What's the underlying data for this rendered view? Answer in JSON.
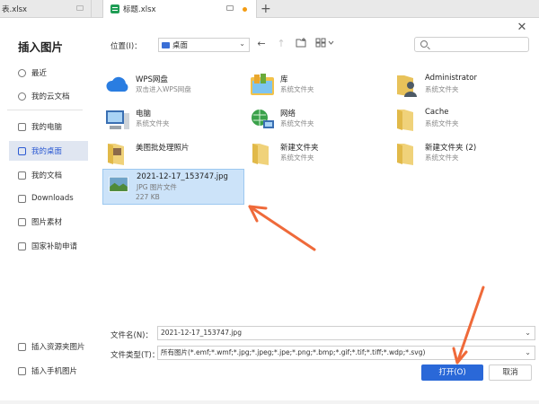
{
  "tabs": {
    "prev_label": "表.xlsx",
    "current_label": "标题.xlsx"
  },
  "dialog": {
    "title": "插入图片",
    "location_label": "位置(I)：",
    "location_value": "桌面"
  },
  "sidebar": {
    "items": [
      {
        "label": "最近",
        "active": false
      },
      {
        "label": "我的云文档",
        "active": false
      },
      {
        "label": "我的电脑",
        "active": false
      },
      {
        "label": "我的桌面",
        "active": true
      },
      {
        "label": "我的文档",
        "active": false
      },
      {
        "label": "Downloads",
        "active": false
      },
      {
        "label": "图片素材",
        "active": false
      },
      {
        "label": "国家补助申请",
        "active": false
      }
    ],
    "bottom": [
      {
        "label": "插入资源夹图片"
      },
      {
        "label": "插入手机图片"
      }
    ]
  },
  "files": [
    {
      "name": "WPS网盘",
      "desc": "双击进入WPS网盘",
      "icon": "cloud-icon"
    },
    {
      "name": "库",
      "desc": "系统文件夹",
      "icon": "library-icon"
    },
    {
      "name": "Administrator",
      "desc": "系统文件夹",
      "icon": "user-folder-icon"
    },
    {
      "name": "电脑",
      "desc": "系统文件夹",
      "icon": "computer-icon"
    },
    {
      "name": "网络",
      "desc": "系统文件夹",
      "icon": "network-icon"
    },
    {
      "name": "Cache",
      "desc": "系统文件夹",
      "icon": "folder-icon"
    },
    {
      "name": "美图批处理照片",
      "desc": "",
      "icon": "folder-icon"
    },
    {
      "name": "新建文件夹",
      "desc": "系统文件夹",
      "icon": "folder-icon"
    },
    {
      "name": "新建文件夹 (2)",
      "desc": "系统文件夹",
      "icon": "folder-icon"
    },
    {
      "name": "2021-12-17_153747.jpg",
      "desc": "JPG 图片文件",
      "size": "227 KB",
      "icon": "image-thumbnail-icon",
      "selected": true
    }
  ],
  "form": {
    "filename_label": "文件名(N)：",
    "filename_value": "2021-12-17_153747.jpg",
    "filetype_label": "文件类型(T)：",
    "filetype_value": "所有图片(*.emf;*.wmf;*.jpg;*.jpeg;*.jpe;*.png;*.bmp;*.gif;*.tif;*.tiff;*.wdp;*.svg)",
    "open_label": "打开(O)",
    "cancel_label": "取消"
  },
  "colors": {
    "accent": "#2a68d8",
    "arrow": "#ef6a3a",
    "selection": "#cce3f9"
  }
}
